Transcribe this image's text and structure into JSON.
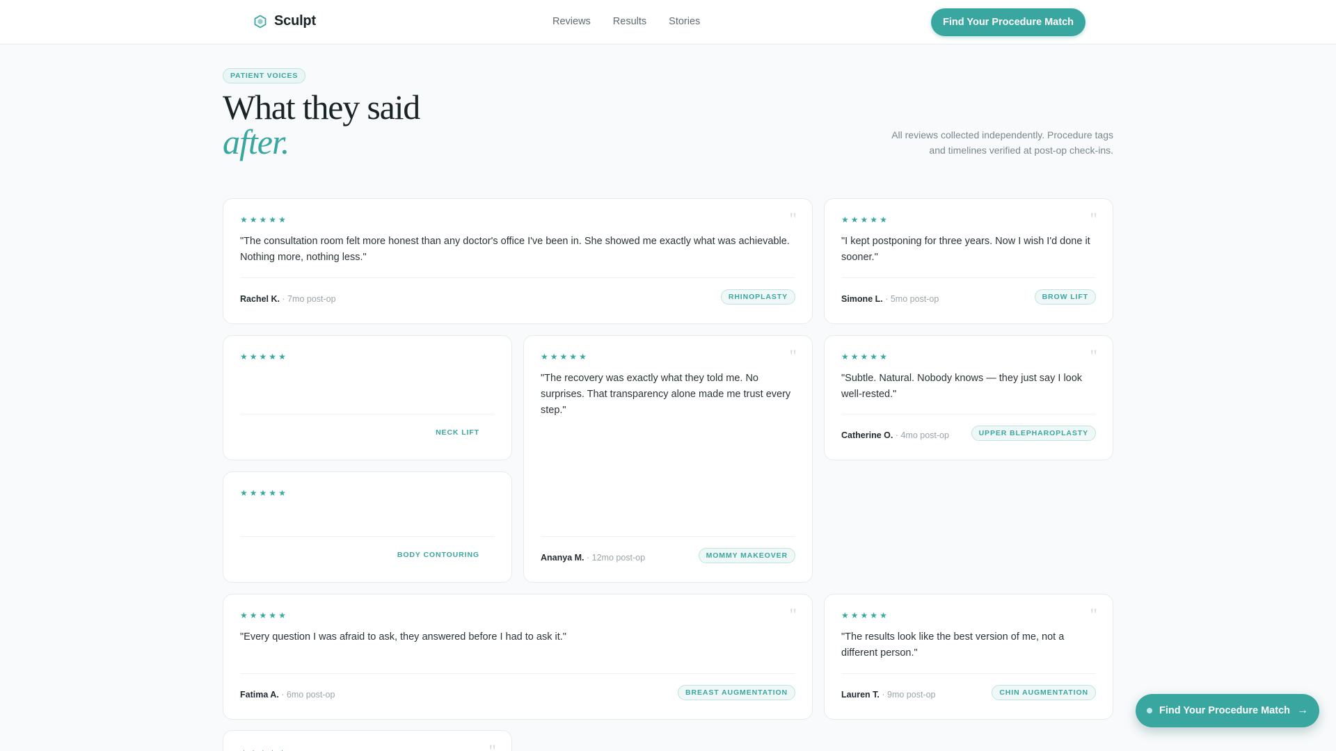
{
  "brand": {
    "name": "Sculpt",
    "icon": "hexagon-logo-icon",
    "accent_color": "#3aa6a0"
  },
  "nav": {
    "links": [
      "Reviews",
      "Results",
      "Stories"
    ],
    "cta_label": "Find Your Procedure Match"
  },
  "hero": {
    "badge": "PATIENT VOICES",
    "title_line1": "What they said",
    "title_accent": "after.",
    "note": "All reviews collected independently. Procedure tags and timelines verified at post-op check-ins."
  },
  "reviews": [
    {
      "rating": 5,
      "quote": "\"The consultation room felt more honest than any doctor's office I've been in. She showed me exactly what was achievable. Nothing more, nothing less.\"",
      "author": "Rachel K.",
      "meta": "· 7mo post-op",
      "tag": "RHINOPLASTY"
    },
    {
      "rating": 5,
      "quote": "\"I kept postponing for three years. Now I wish I'd done it sooner.\"",
      "author": "Simone L.",
      "meta": "· 5mo post-op",
      "tag": "BROW LIFT"
    },
    {
      "rating": 5,
      "quote": "",
      "author": "",
      "meta": "",
      "tag": "NECK LIFT"
    },
    {
      "rating": 5,
      "quote": "\"The recovery was exactly what they told me. No surprises. That transparency alone made me trust every step.\"",
      "author": "Ananya M.",
      "meta": "· 12mo post-op",
      "tag": "MOMMY MAKEOVER"
    },
    {
      "rating": 5,
      "quote": "\"Subtle. Natural. Nobody knows — they just say I look well-rested.\"",
      "author": "Catherine O.",
      "meta": "· 4mo post-op",
      "tag": "UPPER BLEPHAROPLASTY"
    },
    {
      "rating": 5,
      "quote": "",
      "author": "",
      "meta": "",
      "tag": "BODY CONTOURING"
    },
    {
      "rating": 5,
      "quote": "\"Every question I was afraid to ask, they answered before I had to ask it.\"",
      "author": "Fatima A.",
      "meta": "· 6mo post-op",
      "tag": "BREAST AUGMENTATION"
    },
    {
      "rating": 5,
      "quote": "\"The results look like the best version of me, not a different person.\"",
      "author": "Lauren T.",
      "meta": "· 9mo post-op",
      "tag": "CHIN AUGMENTATION"
    },
    {
      "rating": 5
    }
  ],
  "floating_cta": {
    "label": "Find Your Procedure Match",
    "icon": "arrow-right-icon"
  }
}
